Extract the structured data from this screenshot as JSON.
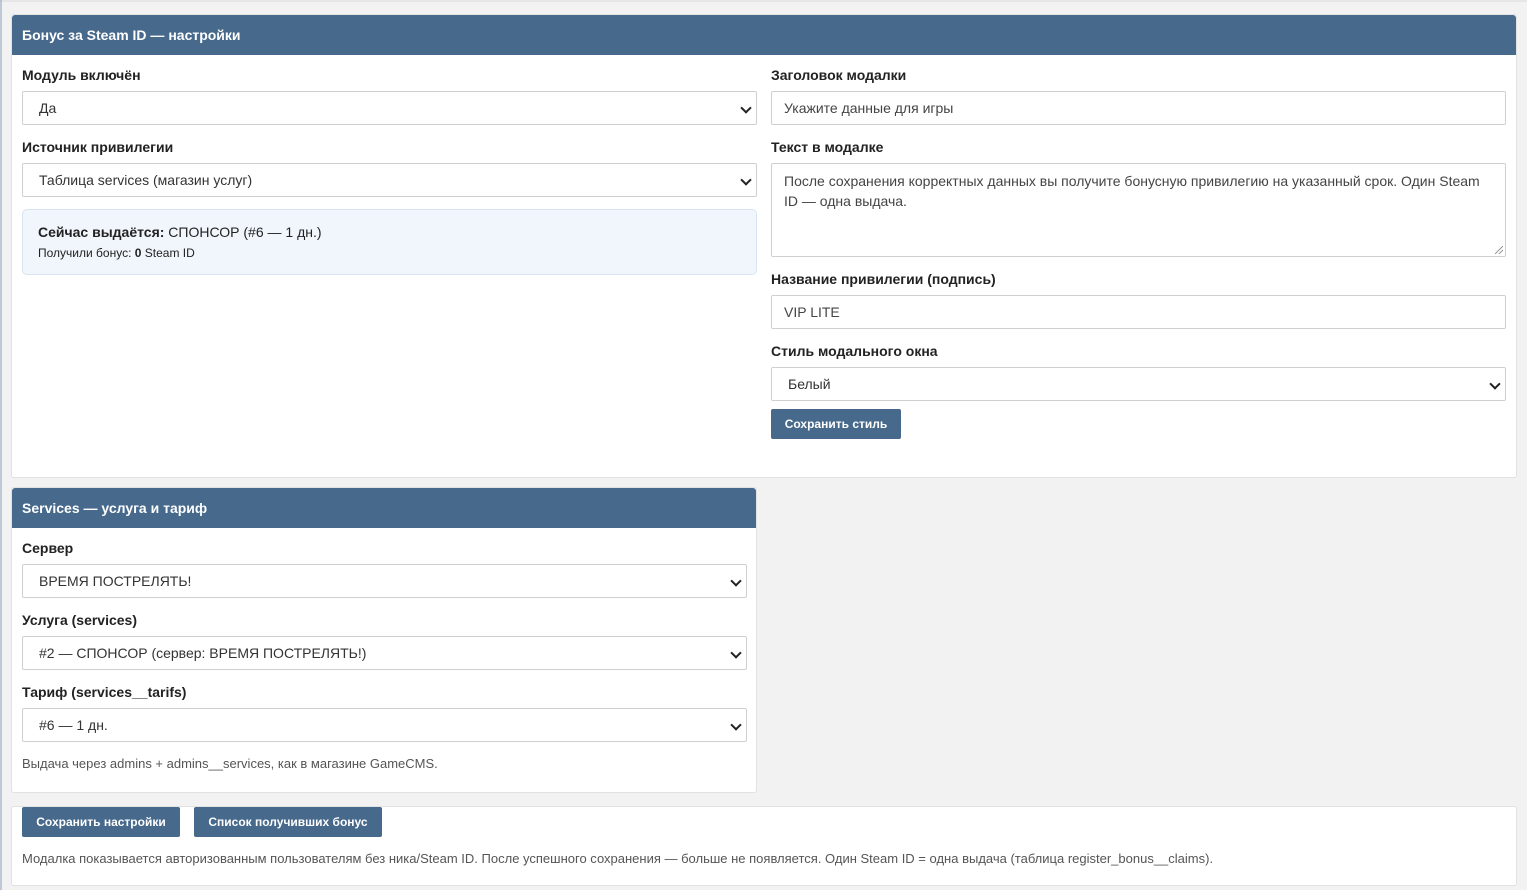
{
  "settings": {
    "title": "Бонус за Steam ID — настройки",
    "module_enabled": {
      "label": "Модуль включён",
      "value": "Да"
    },
    "source": {
      "label": "Источник привилегии",
      "value": "Таблица services (магазин услуг)"
    },
    "current": {
      "prefix": "Сейчас выдаётся:",
      "value": "СПОНСОР (#6 — 1 дн.)",
      "received_prefix": "Получили бонус:",
      "received_count": "0",
      "received_suffix": "Steam ID"
    },
    "modal_title": {
      "label": "Заголовок модалки",
      "value": "Укажите данные для игры"
    },
    "modal_text": {
      "label": "Текст в модалке",
      "value": "После сохранения корректных данных вы получите бонусную привилегию на указанный срок. Один Steam ID — одна выдача."
    },
    "privilege_name": {
      "label": "Название привилегии (подпись)",
      "value": "VIP LITE"
    },
    "modal_style": {
      "label": "Стиль модального окна",
      "value": "Белый"
    },
    "save_style_button": "Сохранить стиль"
  },
  "services": {
    "title": "Services — услуга и тариф",
    "server": {
      "label": "Сервер",
      "value": "ВРЕМЯ ПОСТРЕЛЯТЬ!"
    },
    "service": {
      "label": "Услуга (services)",
      "value": "#2 — СПОНСОР (сервер: ВРЕМЯ ПОСТРЕЛЯТЬ!)"
    },
    "tariff": {
      "label": "Тариф (services__tarifs)",
      "value": "#6 — 1 дн."
    },
    "note": "Выдача через admins + admins__services, как в магазине GameCMS."
  },
  "footer": {
    "save_button": "Сохранить настройки",
    "list_button": "Список получивших бонус",
    "note": "Модалка показывается авторизованным пользователям без ника/Steam ID. После успешного сохранения — больше не появляется. Один Steam ID = одна выдача (таблица register_bonus__claims)."
  },
  "colors": {
    "header": "#46698c",
    "button": "#46698c",
    "info_bg": "#f1f6fc"
  },
  "icons": {
    "select_arrow": "chevron-down-icon",
    "resize": "resize-grip-icon"
  }
}
